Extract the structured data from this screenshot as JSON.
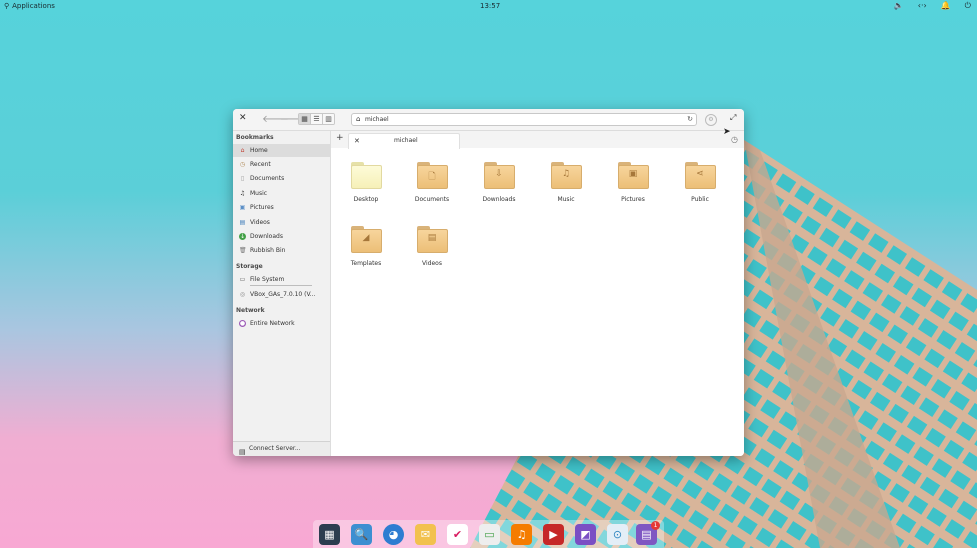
{
  "top_panel": {
    "applications_label": "Applications",
    "clock": "13:57"
  },
  "window": {
    "path": "michael",
    "tab_label": "michael"
  },
  "sidebar": {
    "bookmarks_heading": "Bookmarks",
    "bookmarks": [
      {
        "label": "Home",
        "icon": "home-icon",
        "color": "#c0392b"
      },
      {
        "label": "Recent",
        "icon": "clock-icon",
        "color": "#b08b5a"
      },
      {
        "label": "Documents",
        "icon": "document-icon",
        "color": "#9a9a9a"
      },
      {
        "label": "Music",
        "icon": "music-icon",
        "color": "#333333"
      },
      {
        "label": "Pictures",
        "icon": "picture-icon",
        "color": "#5b8fc7"
      },
      {
        "label": "Videos",
        "icon": "video-icon",
        "color": "#3a7ab8"
      },
      {
        "label": "Downloads",
        "icon": "download-icon",
        "color": "#43a047"
      },
      {
        "label": "Rubbish Bin",
        "icon": "trash-icon",
        "color": "#777777"
      }
    ],
    "storage_heading": "Storage",
    "storage": [
      {
        "label": "File System",
        "icon": "drive-icon"
      },
      {
        "label": "VBox_GAs_7.0.10 (V...",
        "icon": "disc-icon"
      }
    ],
    "network_heading": "Network",
    "network": [
      {
        "label": "Entire Network",
        "icon": "network-icon"
      }
    ],
    "connect_label": "Connect Server..."
  },
  "folders": [
    {
      "name": "Desktop",
      "icon": "folder-desktop-icon",
      "emblem": ""
    },
    {
      "name": "Documents",
      "icon": "folder-documents-icon",
      "emblem": "🗋"
    },
    {
      "name": "Downloads",
      "icon": "folder-downloads-icon",
      "emblem": "⇩"
    },
    {
      "name": "Music",
      "icon": "folder-music-icon",
      "emblem": "♫"
    },
    {
      "name": "Pictures",
      "icon": "folder-pictures-icon",
      "emblem": "▣"
    },
    {
      "name": "Public",
      "icon": "folder-public-icon",
      "emblem": "⋖"
    },
    {
      "name": "Templates",
      "icon": "folder-templates-icon",
      "emblem": "◢"
    },
    {
      "name": "Videos",
      "icon": "folder-videos-icon",
      "emblem": "▤"
    }
  ],
  "dock": [
    {
      "icon": "multitasking-icon",
      "color": "#2c3e50",
      "glyph": "▦"
    },
    {
      "icon": "files-icon",
      "color": "#3d8fd1",
      "glyph": "🔍"
    },
    {
      "icon": "browser-icon",
      "color": "#2e7dd1",
      "glyph": "◕"
    },
    {
      "icon": "mail-icon",
      "color": "#f2c14e",
      "glyph": "✉"
    },
    {
      "icon": "tasks-icon",
      "color": "#ffffff",
      "glyph": "✔"
    },
    {
      "icon": "calendar-icon",
      "color": "#eeeeee",
      "glyph": "▭"
    },
    {
      "icon": "music-app-icon",
      "color": "#f57c00",
      "glyph": "♫"
    },
    {
      "icon": "videos-app-icon",
      "color": "#c62828",
      "glyph": "▶"
    },
    {
      "icon": "photos-app-icon",
      "color": "#7b4fc4",
      "glyph": "◩"
    },
    {
      "icon": "settings-icon",
      "color": "#e3eef7",
      "glyph": "⊙"
    },
    {
      "icon": "appcenter-icon",
      "color": "#7e57c2",
      "glyph": "▤",
      "badge": "1"
    }
  ]
}
